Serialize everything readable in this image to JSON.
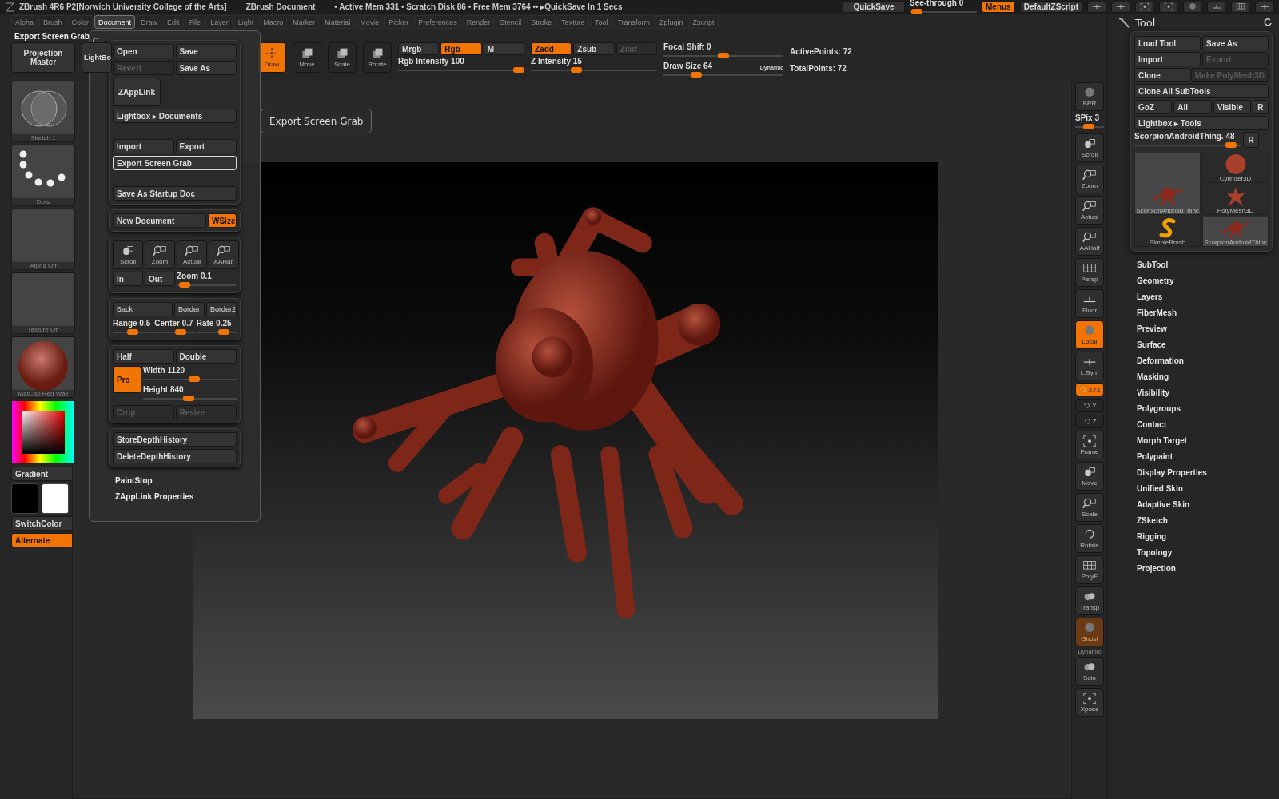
{
  "title_bar": {
    "app_title": "ZBrush 4R6 P2[Norwich University College of the Arts]",
    "document": "ZBrush Document",
    "status": "• Active Mem 331 • Scratch Disk 86 • Free Mem 3764 •• ▸QuickSave In 1 Secs",
    "quicksave": "QuickSave",
    "see_through": {
      "label": "See-through  0",
      "level": 0.03
    },
    "buttons": [
      {
        "label": "Menus",
        "on": true
      },
      {
        "label": "DefaultZScript",
        "on": false
      }
    ]
  },
  "menu_bar": [
    {
      "label": "Alpha",
      "selected": false
    },
    {
      "label": "Brush",
      "selected": false
    },
    {
      "label": "Color",
      "selected": false
    },
    {
      "label": "Document",
      "selected": true
    },
    {
      "label": "Draw",
      "selected": false
    },
    {
      "label": "Edit",
      "selected": false
    },
    {
      "label": "File",
      "selected": false
    },
    {
      "label": "Layer",
      "selected": false
    },
    {
      "label": "Light",
      "selected": false
    },
    {
      "label": "Macro",
      "selected": false
    },
    {
      "label": "Marker",
      "selected": false
    },
    {
      "label": "Material",
      "selected": false
    },
    {
      "label": "Movie",
      "selected": false
    },
    {
      "label": "Picker",
      "selected": false
    },
    {
      "label": "Preferences",
      "selected": false
    },
    {
      "label": "Render",
      "selected": false
    },
    {
      "label": "Stencil",
      "selected": false
    },
    {
      "label": "Stroke",
      "selected": false
    },
    {
      "label": "Texture",
      "selected": false
    },
    {
      "label": "Tool",
      "selected": false
    },
    {
      "label": "Transform",
      "selected": false
    },
    {
      "label": "Zplugin",
      "selected": false
    },
    {
      "label": "Zscript",
      "selected": false
    }
  ],
  "last_used": "Export Screen Grab",
  "top_shelf": {
    "projection_master": "Projection Master",
    "lightbox": "LightBo",
    "transform_modes": [
      {
        "label": "Draw",
        "on": true
      },
      {
        "label": "Move",
        "on": false
      },
      {
        "label": "Scale",
        "on": false
      },
      {
        "label": "Rotate",
        "on": false
      }
    ],
    "rgb_group": {
      "modes": [
        {
          "label": "Mrgb",
          "on": false,
          "disabled": false
        },
        {
          "label": "Rgb",
          "on": true,
          "disabled": false
        },
        {
          "label": "M",
          "on": false,
          "disabled": false
        }
      ],
      "slider": {
        "label": "Rgb Intensity 100",
        "level": 1
      }
    },
    "z_group": {
      "modes": [
        {
          "label": "Zadd",
          "on": true,
          "disabled": false
        },
        {
          "label": "Zsub",
          "on": false,
          "disabled": false
        },
        {
          "label": "Zcut",
          "on": false,
          "disabled": true
        }
      ],
      "slider": {
        "label": "Z Intensity 15",
        "level": 0.35
      }
    },
    "focal_shift": {
      "label": "Focal Shift 0",
      "level": 0.5
    },
    "draw_size": {
      "label": "Draw Size 64",
      "level": 0.25,
      "dynamic": "Dynamic"
    },
    "points": [
      "ActivePoints: 72",
      "TotalPoints: 72"
    ]
  },
  "left_shelf": {
    "brush": "Sketch 1",
    "stroke": "Dots",
    "alpha": "Alpha  Off",
    "texture": "Texture  Off",
    "material": "MatCap  Red  Wax",
    "gradient": "Gradient",
    "switch_color": "SwitchColor",
    "alternate": {
      "label": "Alternate",
      "on": true
    }
  },
  "document_menu": {
    "file_buttons": [
      {
        "label": "Open",
        "disabled": false
      },
      {
        "label": "Save",
        "disabled": false
      },
      {
        "label": "Revert",
        "disabled": true
      },
      {
        "label": "Save As",
        "disabled": false
      }
    ],
    "zapplink": "ZAppLink",
    "lightbox": "Lightbox ▸ Documents",
    "io_buttons": [
      "Import",
      "Export"
    ],
    "export_screen_grab": {
      "label": "Export Screen Grab",
      "selected": true
    },
    "startup": "Save As Startup Doc",
    "new_document": "New Document",
    "wsize": {
      "label": "WSize",
      "on": true
    },
    "view_buttons": [
      "Scroll",
      "Zoom",
      "Actual",
      "AAHalf"
    ],
    "in": "In",
    "out": "Out",
    "zoom": {
      "label": "Zoom 0.1",
      "level": 0.05
    },
    "back_buttons": [
      "Back",
      "Border",
      "Border2"
    ],
    "range_sliders": [
      {
        "label": "Range 0.5",
        "level": 0.5
      },
      {
        "label": "Center 0.7",
        "level": 0.7
      },
      {
        "label": "Rate 0.25",
        "level": 0.75
      }
    ],
    "half": "Half",
    "double": "Double",
    "pro": {
      "label": "Pro",
      "on": true
    },
    "width": {
      "label": "Width 1120",
      "level": 0.55
    },
    "height": {
      "label": "Height 840",
      "level": 0.48
    },
    "crop": {
      "label": "Crop",
      "disabled": true
    },
    "resize": {
      "label": "Resize",
      "disabled": true
    },
    "depth_buttons": [
      "StoreDepthHistory",
      "DeleteDepthHistory"
    ],
    "links": [
      "PaintStop",
      "ZAppLink Properties"
    ]
  },
  "tooltip": "Export Screen Grab",
  "right_shelf": [
    {
      "kind": "button",
      "label": "BPR",
      "on": false,
      "disabled": false
    },
    {
      "kind": "slider",
      "label": "SPix 3",
      "level": 0.45
    },
    {
      "kind": "button",
      "label": "Scroll",
      "on": false,
      "disabled": false
    },
    {
      "kind": "button",
      "label": "Zoom",
      "on": false,
      "disabled": false
    },
    {
      "kind": "button",
      "label": "Actual",
      "on": false,
      "disabled": false
    },
    {
      "kind": "button",
      "label": "AAHalf",
      "on": false,
      "disabled": false
    },
    {
      "kind": "button",
      "label": "Persp",
      "on": false,
      "disabled": false
    },
    {
      "kind": "button",
      "label": "Floor",
      "on": false,
      "disabled": false
    },
    {
      "kind": "button",
      "label": "Local",
      "on": true,
      "disabled": false
    },
    {
      "kind": "button",
      "label": "L.Sym",
      "on": false,
      "disabled": false
    },
    {
      "kind": "small",
      "label": "XYZ",
      "on": true
    },
    {
      "kind": "small",
      "label": "Y",
      "on": false
    },
    {
      "kind": "small",
      "label": "Z",
      "on": false
    },
    {
      "kind": "button",
      "label": "Frame",
      "on": false,
      "disabled": false
    },
    {
      "kind": "button",
      "label": "Move",
      "on": false,
      "disabled": false
    },
    {
      "kind": "button",
      "label": "Scale",
      "on": false,
      "disabled": false
    },
    {
      "kind": "button",
      "label": "Rotate",
      "on": false,
      "disabled": false
    },
    {
      "kind": "button",
      "label": "PolyF",
      "on": false,
      "disabled": false
    },
    {
      "kind": "button",
      "label": "Transp",
      "on": false,
      "disabled": false
    },
    {
      "kind": "button",
      "label": "Ghost",
      "on": true,
      "disabled": true
    },
    {
      "kind": "caption",
      "label": "Dynamic"
    },
    {
      "kind": "button",
      "label": "Solo",
      "on": false,
      "disabled": false
    },
    {
      "kind": "button",
      "label": "Xpose",
      "on": false,
      "disabled": false
    }
  ],
  "tool_panel": {
    "title": "Tool",
    "rows": [
      [
        {
          "label": "Load Tool",
          "disabled": false
        },
        {
          "label": "Save As",
          "disabled": false
        }
      ],
      [
        {
          "label": "Import",
          "disabled": false
        },
        {
          "label": "Export",
          "disabled": true
        }
      ],
      [
        {
          "label": "Clone",
          "disabled": false
        },
        {
          "label": "Make PolyMesh3D",
          "disabled": true
        }
      ],
      [
        {
          "label": "Clone  All  SubTools",
          "disabled": false
        }
      ],
      [
        {
          "label": "GoZ",
          "disabled": false
        },
        {
          "label": "All",
          "disabled": false
        },
        {
          "label": "Visible",
          "disabled": false
        },
        {
          "label": "R",
          "disabled": false
        }
      ],
      [
        {
          "label": "Lightbox ▸ Tools",
          "disabled": false
        }
      ]
    ],
    "slider": {
      "label": "ScorpionAndroidThing. 48",
      "level": 0.95,
      "button": "R"
    },
    "thumbnails": [
      {
        "label": "ScorpionAndroidThinc",
        "selected": true
      },
      {
        "label": "SimpleBrush",
        "selected": false
      },
      {
        "label": "Cylinder3D",
        "selected": false
      },
      {
        "label": "PolyMesh3D",
        "selected": false
      },
      {
        "label": "ScorpionAndroidThinc",
        "selected": true
      }
    ],
    "subpalettes": [
      "SubTool",
      "Geometry",
      "Layers",
      "FiberMesh",
      "Preview",
      "Surface",
      "Deformation",
      "Masking",
      "Visibility",
      "Polygroups",
      "Contact",
      "Morph  Target",
      "Polypaint",
      "Display  Properties",
      "Unified  Skin",
      "Adaptive  Skin",
      "ZSketch",
      "Rigging",
      "Topology",
      "Projection"
    ]
  }
}
